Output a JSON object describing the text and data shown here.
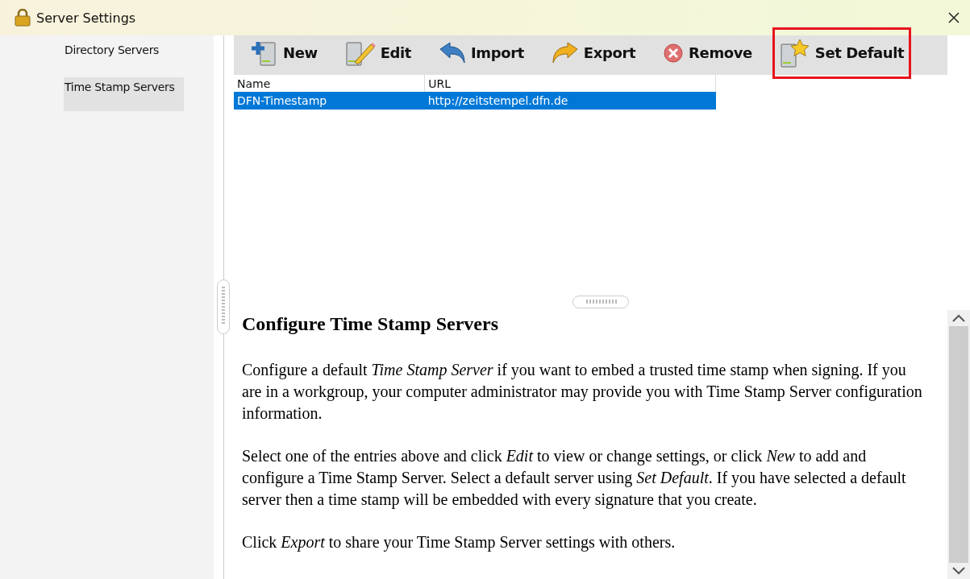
{
  "window": {
    "title": "Server Settings"
  },
  "sidebar": {
    "items": [
      {
        "label": "Directory Servers",
        "selected": false
      },
      {
        "label": "Time Stamp Servers",
        "selected": true
      }
    ]
  },
  "toolbar": [
    {
      "kind": "new",
      "label": "New",
      "highlighted": false
    },
    {
      "kind": "edit",
      "label": "Edit",
      "highlighted": false
    },
    {
      "kind": "import",
      "label": "Import",
      "highlighted": false
    },
    {
      "kind": "export",
      "label": "Export",
      "highlighted": false
    },
    {
      "kind": "remove",
      "label": "Remove",
      "highlighted": false
    },
    {
      "kind": "default",
      "label": "Set Default",
      "highlighted": true
    }
  ],
  "table": {
    "columns": [
      "Name",
      "URL"
    ],
    "rows": [
      {
        "cells": [
          "DFN-Timestamp",
          "http://zeitstempel.dfn.de"
        ],
        "selected": true
      }
    ]
  },
  "help": {
    "heading": "Configure Time Stamp Servers",
    "paragraphs": [
      "Configure a default *Time Stamp Server* if you want to embed a trusted time stamp when signing. If you are in a workgroup, your computer administrator may provide you with Time Stamp Server configuration information.",
      "Select one of the entries above and click *Edit* to view or change settings, or click *New* to add and configure a Time Stamp Server. Select a default server using *Set Default*. If you have selected a default server then a time stamp will be embedded with every signature that you create.",
      "Click *Export* to share your Time Stamp Server settings with others."
    ]
  }
}
